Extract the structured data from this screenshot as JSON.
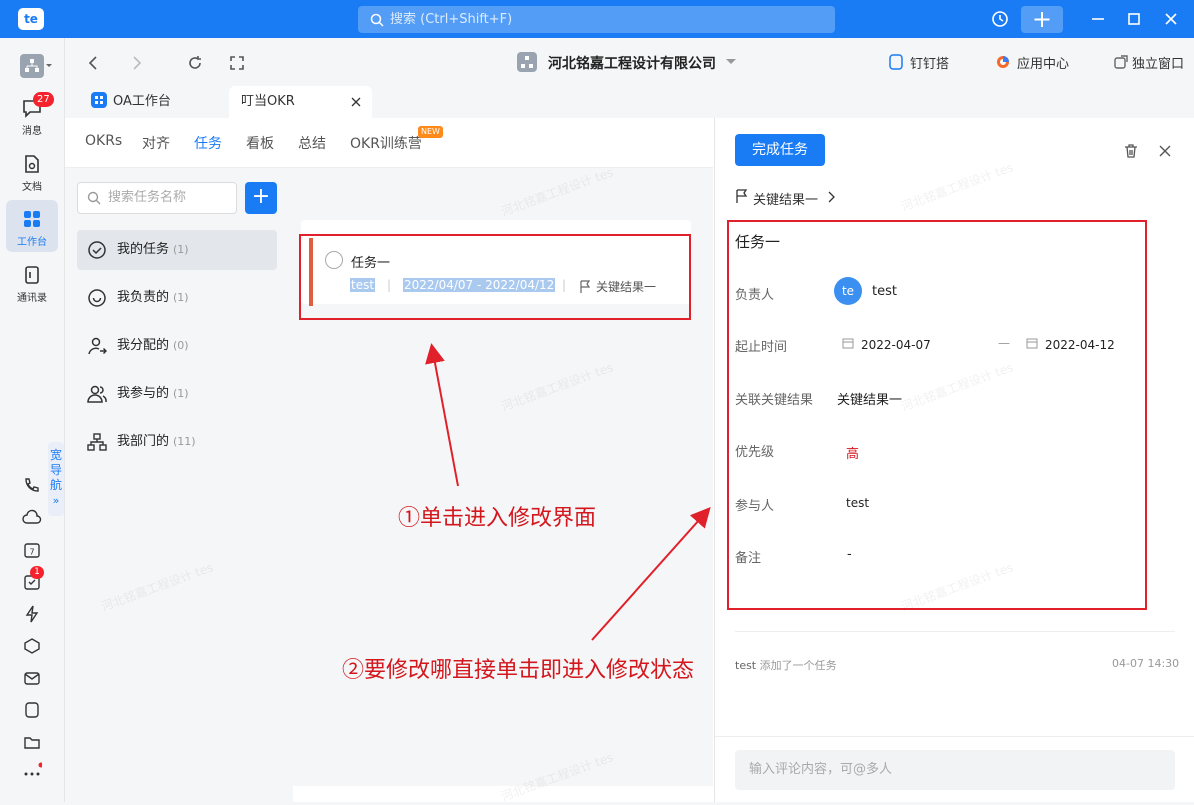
{
  "titlebar": {
    "avatar": "te",
    "search_placeholder": "搜索 (Ctrl+Shift+F)"
  },
  "leftnav": {
    "items": [
      {
        "label": "消息",
        "badge": "27"
      },
      {
        "label": "文档"
      },
      {
        "label": "工作台"
      },
      {
        "label": "通讯录"
      }
    ],
    "wide_nav": "宽导航",
    "todo_badge": "1"
  },
  "toolbar": {
    "company": "河北铭嘉工程设计有限公司",
    "dingdingda": "钉钉搭",
    "app_center": "应用中心",
    "standalone": "独立窗口"
  },
  "tabs": [
    {
      "label": "OA工作台"
    },
    {
      "label": "叮当OKR"
    }
  ],
  "subnav": {
    "items": [
      "OKRs",
      "对齐",
      "任务",
      "看板",
      "总结",
      "OKR训练营"
    ],
    "new_tag": "NEW"
  },
  "tasks_panel": {
    "search_placeholder": "搜索任务名称",
    "filters": [
      {
        "label": "我的任务",
        "count": "(1)"
      },
      {
        "label": "我负责的",
        "count": "(1)"
      },
      {
        "label": "我分配的",
        "count": "(0)"
      },
      {
        "label": "我参与的",
        "count": "(1)"
      },
      {
        "label": "我部门的",
        "count": "(11)"
      }
    ]
  },
  "task": {
    "title": "任务一",
    "owner": "test",
    "date_range": "2022/04/07 - 2022/04/12",
    "key_result": "关键结果一"
  },
  "detail": {
    "complete_button": "完成任务",
    "breadcrumb": "关键结果一",
    "title": "任务一",
    "owner_label": "负责人",
    "owner_avatar": "te",
    "owner_name": "test",
    "date_label": "起止时间",
    "start_date": "2022-04-07",
    "date_sep": "—",
    "end_date": "2022-04-12",
    "kr_label": "关联关键结果",
    "kr_value": "关键结果一",
    "priority_label": "优先级",
    "priority_value": "高",
    "participants_label": "参与人",
    "participants_value": "test",
    "notes_label": "备注",
    "notes_value": "-",
    "activity_user": "test",
    "activity_text": "添加了一个任务",
    "activity_time": "04-07 14:30",
    "comment_placeholder": "输入评论内容，可@多人"
  },
  "annotations": {
    "step1": "①单击进入修改界面",
    "step2": "②要修改哪直接单击即进入修改状态"
  },
  "watermark": "河北铭嘉工程设计 tes",
  "colors": {
    "primary": "#1a7cf5",
    "annotation": "#e0202a",
    "priority_high": "#d4161d",
    "task_bar": "#e05e3e"
  }
}
